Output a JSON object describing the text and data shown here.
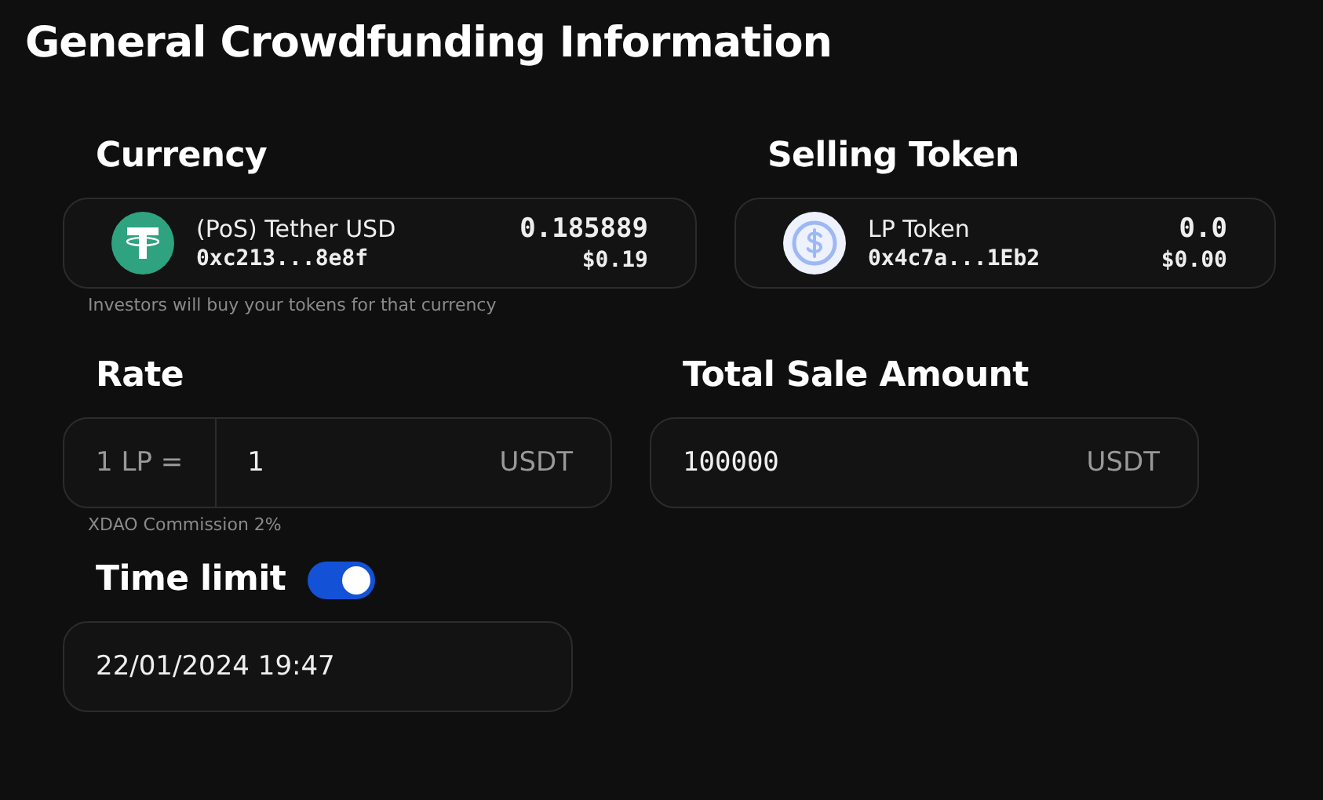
{
  "title": "General Crowdfunding Information",
  "tokens": [
    {
      "label": "Currency",
      "kind": "tether",
      "name": "(PoS) Tether USD",
      "address": "0xc213...8e8f",
      "balance": "0.185889",
      "value": "$0.19",
      "hint": "Investors will buy your tokens for that currency"
    },
    {
      "label": "Selling Token",
      "kind": "coin",
      "name": "LP Token",
      "address": "0x4c7a...1Eb2",
      "balance": "0.0",
      "value": "$0.00"
    }
  ],
  "rate": {
    "label": "Rate",
    "prefix": "1 LP =",
    "value": "1",
    "unit": "USDT",
    "hint": "XDAO Commission 2%"
  },
  "total_sale": {
    "label": "Total Sale Amount",
    "value": "100000",
    "unit": "USDT"
  },
  "time_limit": {
    "label": "Time limit",
    "on": true,
    "value": "22/01/2024 19:47"
  }
}
